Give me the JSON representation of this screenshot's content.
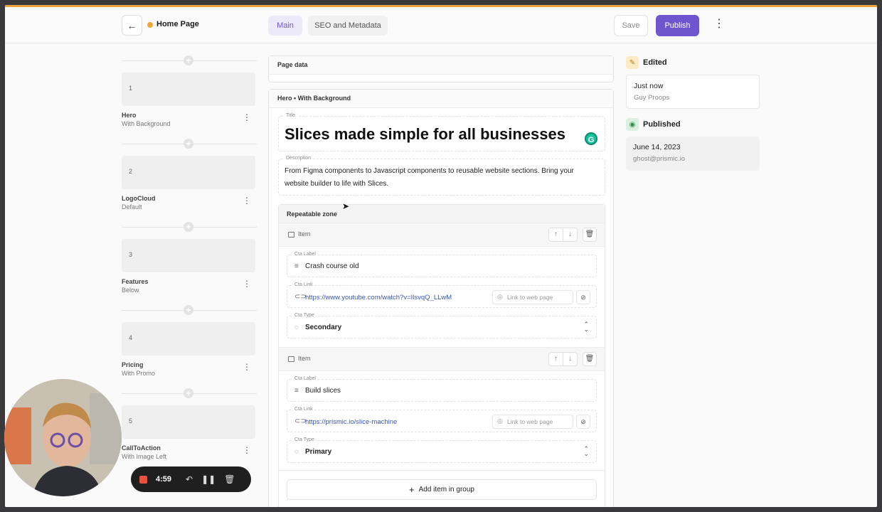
{
  "header": {
    "back_icon": "arrow-left-icon",
    "doc_title": "Home Page",
    "doc_status_color": "#f0a43a",
    "tabs": [
      {
        "label": "Main",
        "active": true
      },
      {
        "label": "SEO and Metadata",
        "active": false
      }
    ],
    "save_label": "Save",
    "publish_label": "Publish",
    "accent_color": "#6e56cf"
  },
  "slices": [
    {
      "num": "1",
      "name": "Hero",
      "variant": "With Background"
    },
    {
      "num": "2",
      "name": "LogoCloud",
      "variant": "Default"
    },
    {
      "num": "3",
      "name": "Features",
      "variant": "Below"
    },
    {
      "num": "4",
      "name": "Pricing",
      "variant": "With Promo"
    },
    {
      "num": "5",
      "name": "CallToAction",
      "variant": "With Image Left"
    }
  ],
  "main": {
    "page_data_label": "Page data",
    "hero_panel_label": "Hero • With Background",
    "title_label": "Title",
    "title_value": "Slices made simple for all businesses",
    "description_label": "Description",
    "description_value": "From Figma components to Javascript components to reusable website sections. Bring your website builder to life with Slices.",
    "repeatable_zone_label": "Repeatable zone",
    "items": [
      {
        "label": "Item",
        "cta_label_label": "Cta Label",
        "cta_label_value": "Crash course old",
        "cta_link_label": "Cta Link",
        "cta_link_value": "https://www.youtube.com/watch?v=IlsvqQ_LLwM",
        "link_type": "Link to web page",
        "cta_type_label": "Cta Type",
        "cta_type_value": "Secondary"
      },
      {
        "label": "Item",
        "cta_label_label": "Cta Label",
        "cta_label_value": "Build slices",
        "cta_link_label": "Cta Link",
        "cta_link_value": "https://prismic.io/slice-machine",
        "link_type": "Link to web page",
        "cta_type_label": "Cta Type",
        "cta_type_value": "Primary"
      }
    ],
    "add_item_label": "Add item in group"
  },
  "sidebar": {
    "edited_label": "Edited",
    "edited_time": "Just now",
    "edited_by": "Guy Proops",
    "published_label": "Published",
    "published_date": "June 14, 2023",
    "published_by": "ghost@prismic.io",
    "edited_icon": "pencil-icon",
    "published_icon": "globe-icon"
  },
  "recorder": {
    "time": "4:59"
  }
}
